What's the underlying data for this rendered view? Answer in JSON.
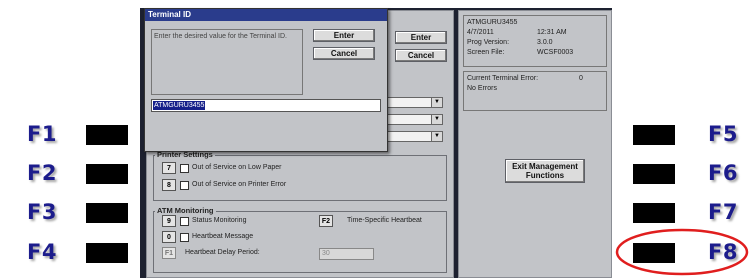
{
  "fkeys": {
    "left": [
      "F1",
      "F2",
      "F3",
      "F4"
    ],
    "right": [
      "F5",
      "F6",
      "F7",
      "F8"
    ]
  },
  "dialog": {
    "title": "Terminal ID",
    "prompt": "Enter the desired value for the Terminal ID.",
    "enter_label": "Enter",
    "cancel_label": "Cancel",
    "value": "ATMGURU3455"
  },
  "main": {
    "enter_label": "Enter",
    "cancel_label": "Cancel",
    "printer_settings_label": "Printer Settings",
    "printer_items": [
      {
        "key": "7",
        "label": "Out of Service on Low Paper"
      },
      {
        "key": "8",
        "label": "Out of Service on Printer Error"
      }
    ],
    "atm_monitoring_label": "ATM Monitoring",
    "monitor_items": [
      {
        "key": "9",
        "label": "Status Monitoring"
      },
      {
        "key": "0",
        "label": "Heartbeat Message"
      }
    ],
    "f1_key": "F1",
    "delay_label": "Heartbeat Delay Period:",
    "delay_value": "30",
    "f2_key": "F2",
    "time_specific_label": "Time-Specific Heartbeat"
  },
  "info": {
    "terminal": "ATMGURU3455",
    "date": "4/7/2011",
    "time": "12:31 AM",
    "prog_version_label": "Prog Version:",
    "prog_version": "3.0.0",
    "screen_file_label": "Screen File:",
    "screen_file": "WCSF0003",
    "error_label": "Current Terminal Error:",
    "error_code": "0",
    "error_text": "No Errors",
    "exit_label_1": "Exit Management",
    "exit_label_2": "Functions"
  },
  "colors": {
    "fkey_text": "#1c1c8c",
    "highlight_circle": "#e01e1e",
    "dialog_title_bg": "#2a3c8c",
    "selected_text_bg": "#16208a"
  }
}
